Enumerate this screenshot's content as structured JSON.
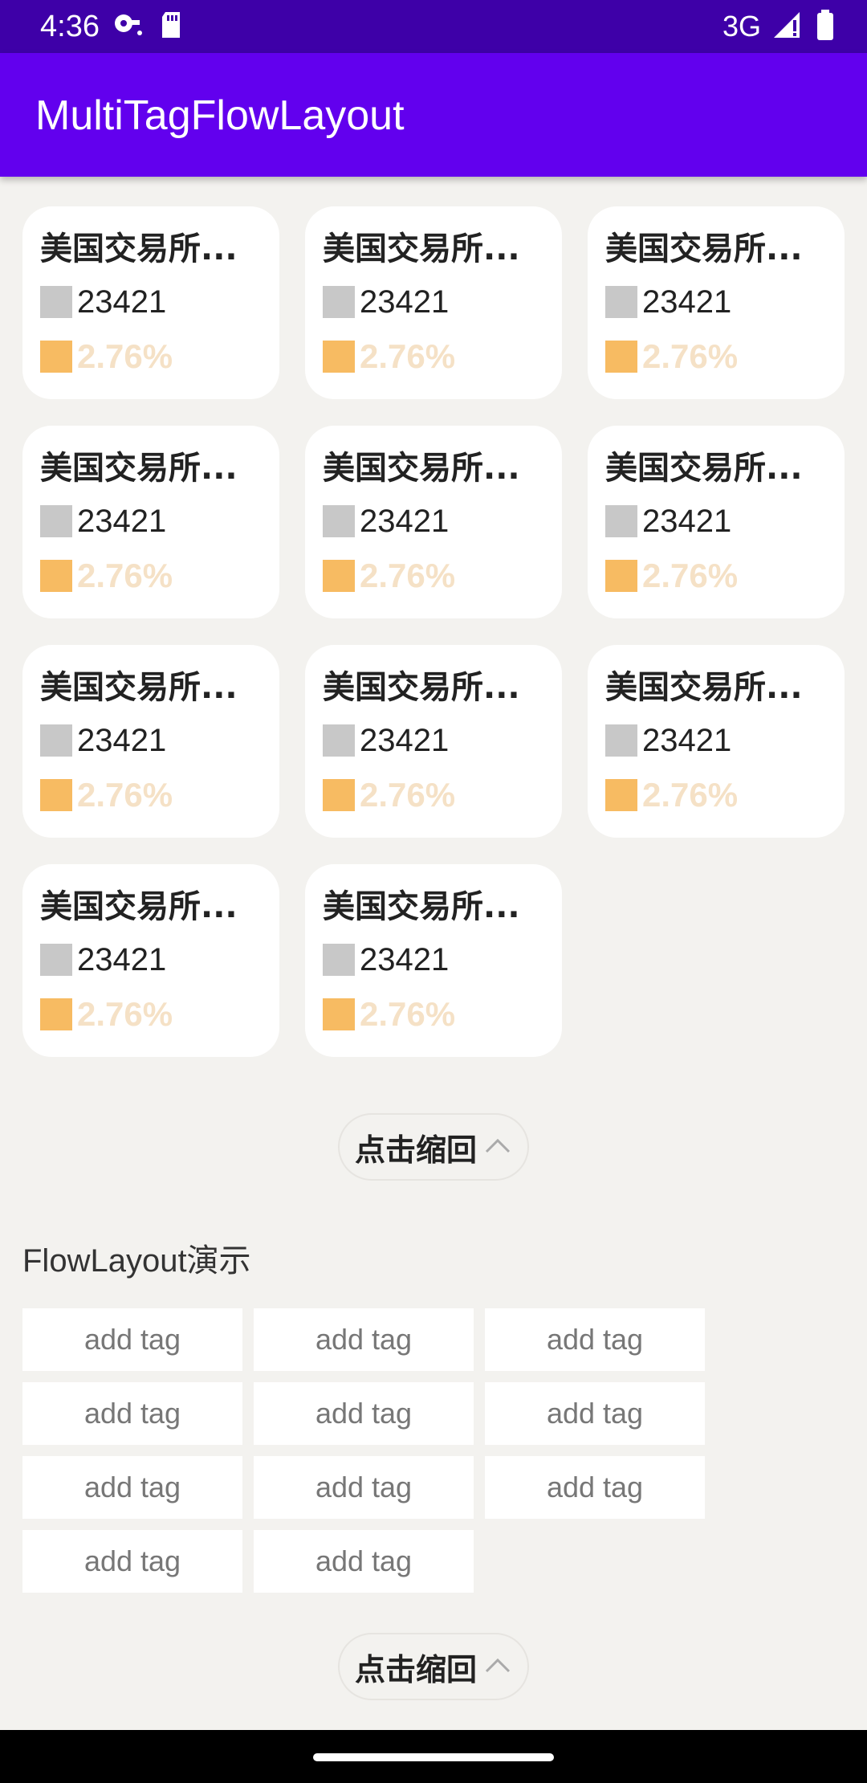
{
  "status_bar": {
    "time": "4:36",
    "network": "3G",
    "icons": [
      "vpn-key-icon",
      "sd-card-icon",
      "signal-icon",
      "battery-icon"
    ]
  },
  "app_bar": {
    "title": "MultiTagFlowLayout"
  },
  "cards_section": {
    "cards": [
      {
        "name": "美国交易所...",
        "count": "23421",
        "percent": "2.76%"
      },
      {
        "name": "美国交易所...",
        "count": "23421",
        "percent": "2.76%"
      },
      {
        "name": "美国交易所...",
        "count": "23421",
        "percent": "2.76%"
      },
      {
        "name": "美国交易所...",
        "count": "23421",
        "percent": "2.76%"
      },
      {
        "name": "美国交易所...",
        "count": "23421",
        "percent": "2.76%"
      },
      {
        "name": "美国交易所...",
        "count": "23421",
        "percent": "2.76%"
      },
      {
        "name": "美国交易所...",
        "count": "23421",
        "percent": "2.76%"
      },
      {
        "name": "美国交易所...",
        "count": "23421",
        "percent": "2.76%"
      },
      {
        "name": "美国交易所...",
        "count": "23421",
        "percent": "2.76%"
      },
      {
        "name": "美国交易所...",
        "count": "23421",
        "percent": "2.76%"
      },
      {
        "name": "美国交易所...",
        "count": "23421",
        "percent": "2.76%"
      }
    ],
    "collapse_label": "点击缩回"
  },
  "flow_section": {
    "title": "FlowLayout演示",
    "tags": [
      "add tag",
      "add tag",
      "add tag",
      "add tag",
      "add tag",
      "add tag",
      "add tag",
      "add tag",
      "add tag",
      "add tag",
      "add tag"
    ],
    "collapse_label": "点击缩回"
  },
  "colors": {
    "status_bar": "#3e00a8",
    "app_bar": "#6200ee",
    "background": "#f3f2ef",
    "count_marker": "#c8c8c8",
    "percent_marker": "#f7bb62",
    "percent_text": "#f5e1c6"
  }
}
